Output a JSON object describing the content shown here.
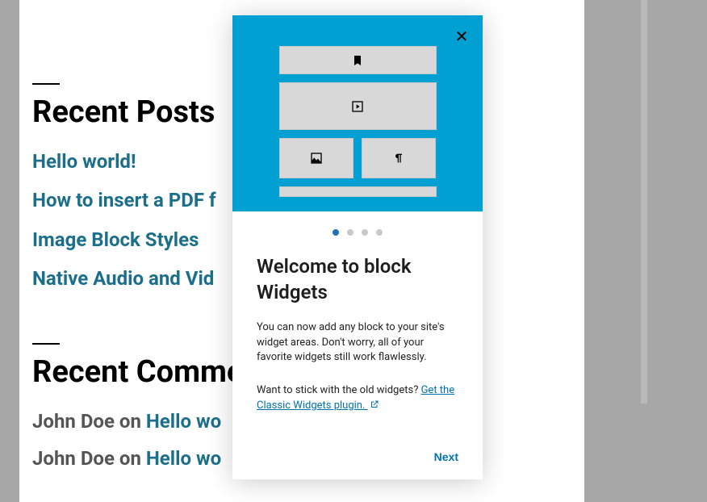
{
  "sections": {
    "recent_posts": {
      "title": "Recent Posts",
      "items": [
        "Hello world!",
        "How to insert a PDF f",
        "Image Block Styles",
        "Native Audio and Vid"
      ]
    },
    "recent_comments": {
      "title": "Recent Comme",
      "items": [
        {
          "author": "John Doe",
          "on": "on",
          "post": "Hello wo"
        },
        {
          "author": "John Doe",
          "on": "on",
          "post": "Hello wo"
        }
      ]
    }
  },
  "modal": {
    "close_label": "✕",
    "pagination": {
      "total": 4,
      "active": 0
    },
    "title": "Welcome to block Widgets",
    "paragraph1": "You can now add any block to your site's widget areas. Don't worry, all of your favorite widgets still work flawlessly.",
    "paragraph2_prefix": "Want to stick with the old widgets? ",
    "link_text": "Get the Classic Widgets plugin.",
    "next_label": "Next"
  }
}
